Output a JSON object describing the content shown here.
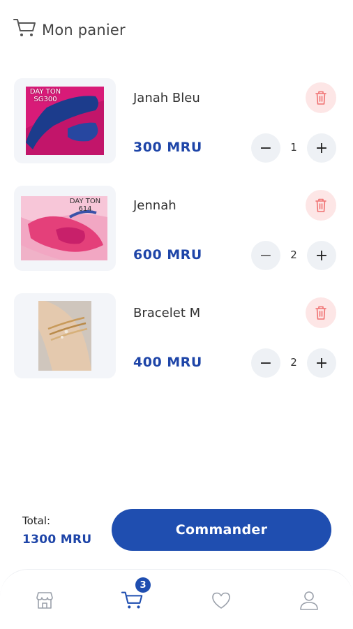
{
  "header": {
    "title": "Mon panier"
  },
  "cart": {
    "items": [
      {
        "name": "Janah Bleu",
        "price": "300 MRU",
        "qty": "1",
        "image_tag": "DAY TON\nSG300"
      },
      {
        "name": "Jennah",
        "price": "600 MRU",
        "qty": "2",
        "image_tag": "DAY TON\n614"
      },
      {
        "name": "Bracelet M",
        "price": "400 MRU",
        "qty": "2",
        "image_tag": ""
      }
    ]
  },
  "summary": {
    "total_label": "Total:",
    "total_value": "1300 MRU",
    "order_button": "Commander"
  },
  "nav": {
    "cart_badge": "3",
    "active": "cart"
  },
  "colors": {
    "accent": "#1f4eb0",
    "price": "#1e45a8",
    "delete_bg": "#fde6e6",
    "delete_icon": "#f07070"
  }
}
